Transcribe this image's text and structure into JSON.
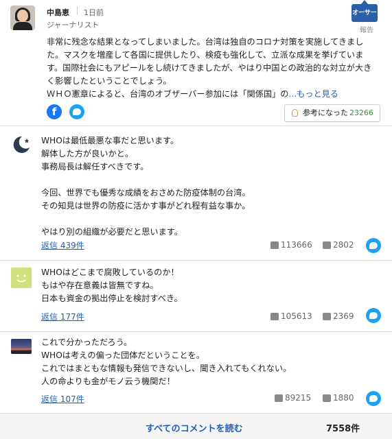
{
  "author": {
    "name": "中島恵",
    "time": "1日前",
    "role": "ジャーナリスト",
    "badge": "オーサー",
    "report": "報告",
    "body": "非常に残念な結果となってしまいました。台湾は独自のコロナ対策を実施してきました。マスクを増産して各国に提供したり、検疫も強化して、立派な成果を挙げています。国際社会にもアピールをし続けてきましたが、やはり中国との政治的な対立が大きく影響したということでしょう。",
    "body2": "ＷＨＯ憲章によると、台湾のオブザーバー参加には「関係国」の",
    "more": "...もっと見る",
    "helpful_label": "参考になった",
    "helpful_count": "23266"
  },
  "comments": [
    {
      "text": "WHOは最低最悪な事だと思います。\n解体した方が良いかと。\n事務局長は解任すべきです。\n\n今回、世界でも優秀な成績をおさめた防疫体制の台湾。\nその知見は世界の防疫に活かす事がどれ程有益な事か。\n\nやはり別の組織が必要だと思います。",
      "reply": "返信 439件",
      "likes": "113666",
      "dislikes": "2802"
    },
    {
      "text": "WHOはどこまで腐敗しているのか！\nもはや存在意義は皆無ですね。\n日本も資金の拠出停止を検討すべき。",
      "reply": "返信 177件",
      "likes": "105613",
      "dislikes": "2369"
    },
    {
      "text": "これで分かっただろう。\nWHOは考えの偏った団体だということを。\nこれではまともな情報も発信できないし、聞き入れてもくれない。\n人の命よりも金がモノ云う機関だ！",
      "reply": "返信 107件",
      "likes": "89215",
      "dislikes": "1880"
    }
  ],
  "footer": {
    "read_all": "すべてのコメントを読む",
    "count": "7558件"
  }
}
